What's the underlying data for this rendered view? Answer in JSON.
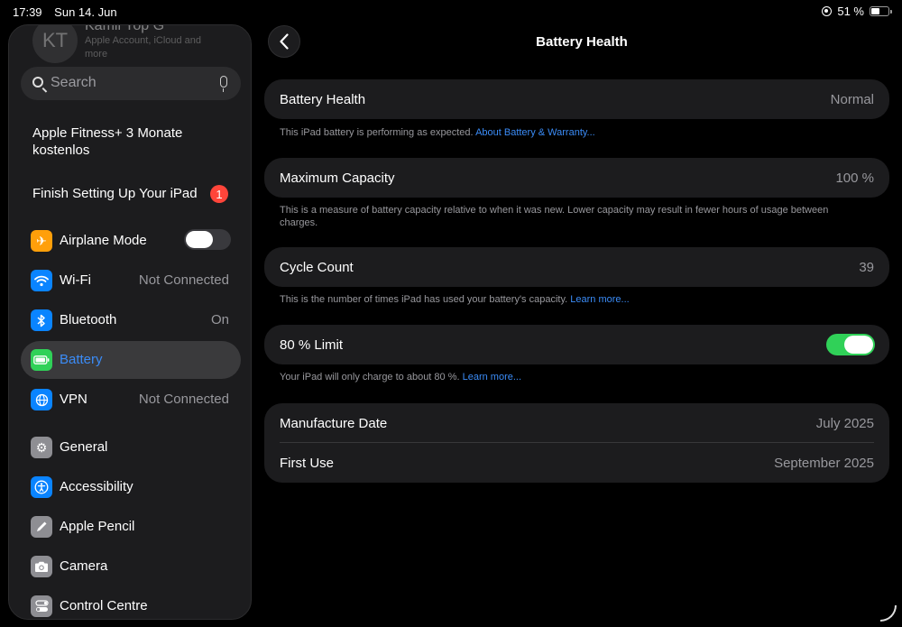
{
  "status_bar": {
    "time": "17:39",
    "date": "Sun 14. Jun",
    "battery_percent": "51 %",
    "battery_level": 0.51
  },
  "sidebar": {
    "account": {
      "initials": "KT",
      "name": "Kamil Yop G",
      "subtitle": "Apple Account, iCloud and more"
    },
    "search": {
      "placeholder": "Search"
    },
    "promo": "Apple Fitness+ 3 Monate kostenlos",
    "finish_setup": {
      "label": "Finish Setting Up Your iPad",
      "badge": "1"
    },
    "items": [
      {
        "label": "Airplane Mode",
        "value": "",
        "icon": "airplane-icon",
        "color": "#ff9f0a"
      },
      {
        "label": "Wi-Fi",
        "value": "Not Connected",
        "icon": "wifi-icon",
        "color": "#0a84ff"
      },
      {
        "label": "Bluetooth",
        "value": "On",
        "icon": "bluetooth-icon",
        "color": "#0a84ff"
      },
      {
        "label": "Battery",
        "value": "",
        "icon": "battery-icon",
        "color": "#30d158"
      },
      {
        "label": "VPN",
        "value": "Not Connected",
        "icon": "vpn-globe-icon",
        "color": "#0a84ff"
      },
      {
        "label": "General",
        "value": "",
        "icon": "gear-icon",
        "color": "#8e8e93"
      },
      {
        "label": "Accessibility",
        "value": "",
        "icon": "accessibility-icon",
        "color": "#0a84ff"
      },
      {
        "label": "Apple Pencil",
        "value": "",
        "icon": "pencil-icon",
        "color": "#8e8e93"
      },
      {
        "label": "Camera",
        "value": "",
        "icon": "camera-icon",
        "color": "#8e8e93"
      },
      {
        "label": "Control Centre",
        "value": "",
        "icon": "control-centre-icon",
        "color": "#8e8e93"
      }
    ],
    "selected": "Battery",
    "airplane_mode_on": false
  },
  "main": {
    "title": "Battery Health",
    "battery_health": {
      "label": "Battery Health",
      "value": "Normal"
    },
    "battery_health_footer": {
      "text": "This iPad battery is performing as expected. ",
      "link": "About Battery & Warranty..."
    },
    "max_capacity": {
      "label": "Maximum Capacity",
      "value": "100 %"
    },
    "max_capacity_footer": "This is a measure of battery capacity relative to when it was new. Lower capacity may result in fewer hours of usage between charges.",
    "cycle_count": {
      "label": "Cycle Count",
      "value": "39"
    },
    "cycle_count_footer": {
      "text": "This is the number of times iPad has used your battery's capacity. ",
      "link": "Learn more..."
    },
    "limit": {
      "label": "80 % Limit",
      "on": true
    },
    "limit_footer": {
      "text": "Your iPad will only charge to about 80 %. ",
      "link": "Learn more..."
    },
    "manufacture_date": {
      "label": "Manufacture Date",
      "value": "July 2025"
    },
    "first_use": {
      "label": "First Use",
      "value": "September 2025"
    }
  }
}
